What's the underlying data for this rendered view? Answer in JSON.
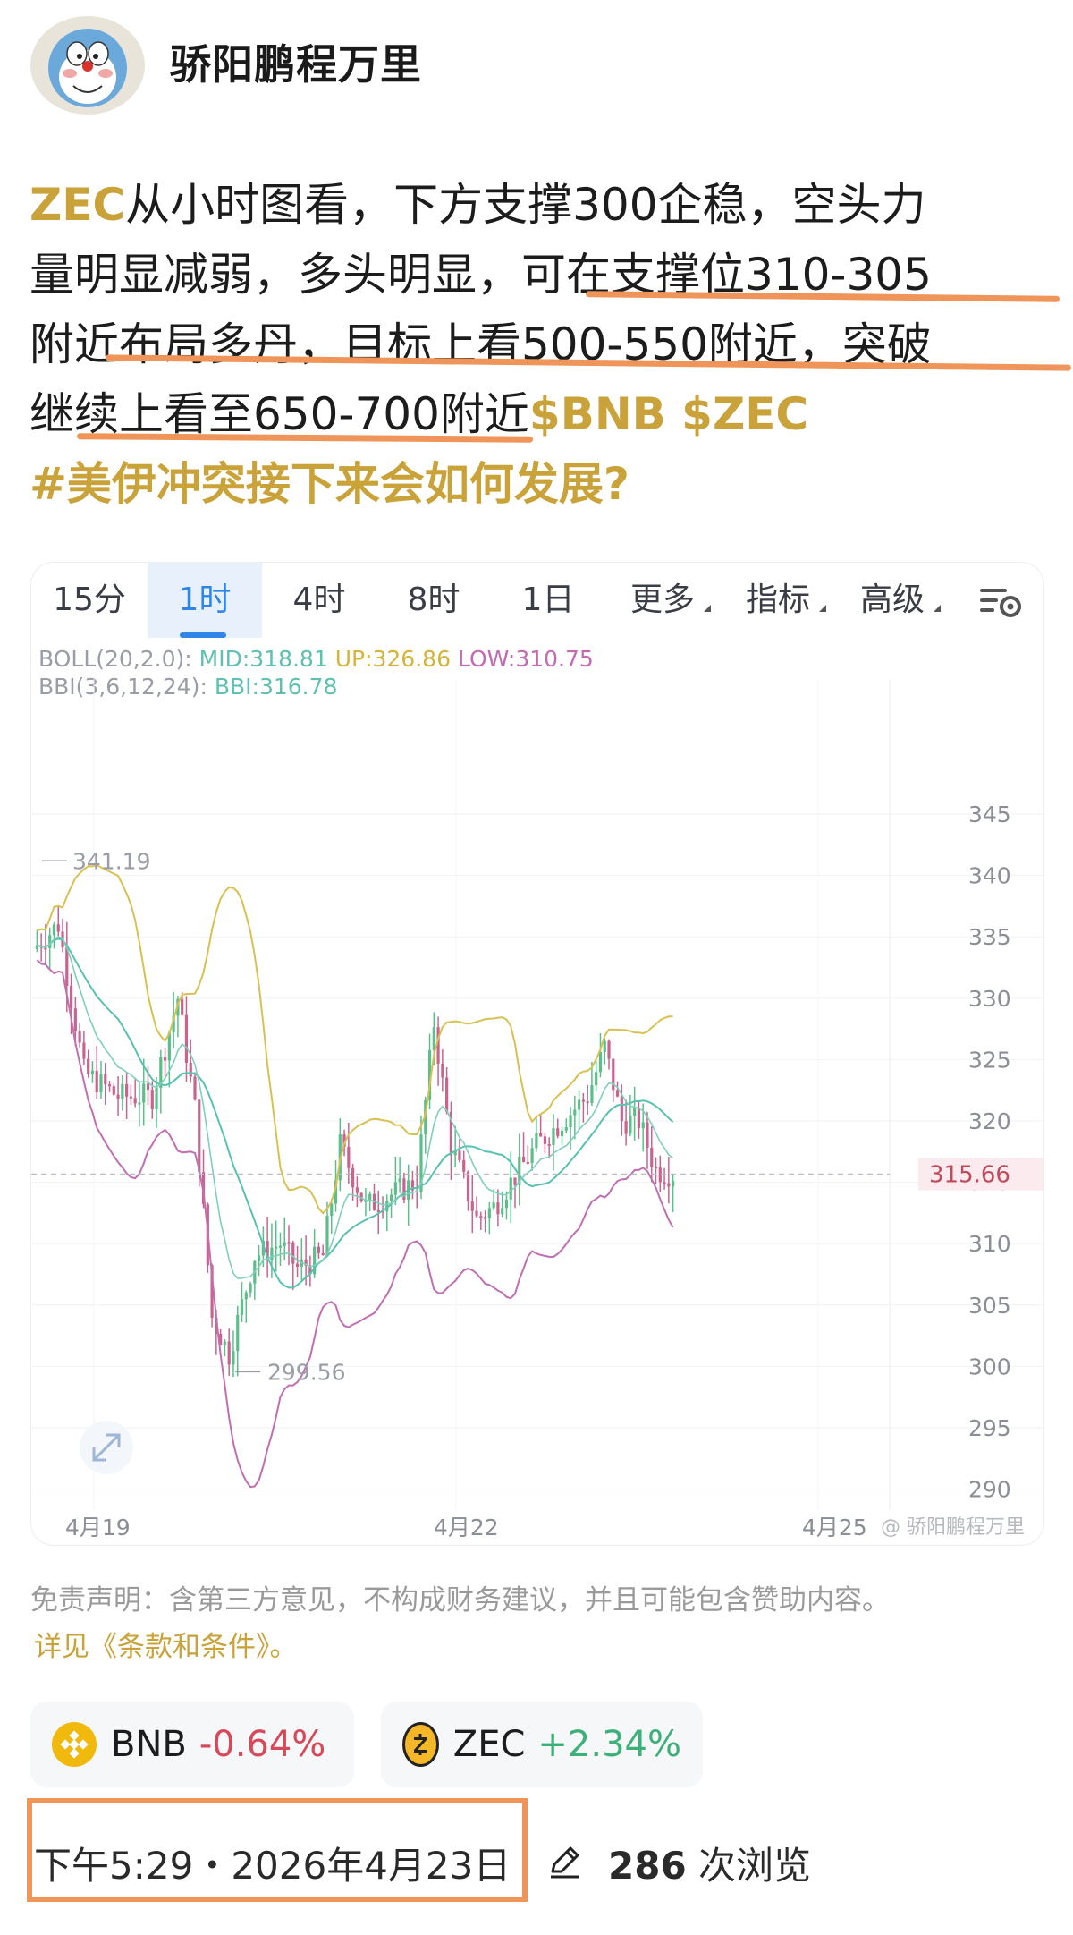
{
  "author": {
    "name": "骄阳鹏程万里"
  },
  "post": {
    "lines": [
      {
        "gold": "ZEC",
        "text": "从小时图看，下方支撑300企稳，空头力"
      },
      {
        "text": "量明显减弱，多头明显，可在支撑位310-305"
      },
      {
        "text": "附近布局多丹，目标上看500-550附近，突破"
      },
      {
        "text": "继续上看至650-700附近",
        "gold": "$BNB $ZEC"
      },
      {
        "gold": "#美伊冲突接下来会如何发展?"
      }
    ]
  },
  "chart": {
    "tabs": [
      {
        "label": "15分",
        "active": false
      },
      {
        "label": "1时",
        "active": true
      },
      {
        "label": "4时",
        "active": false
      },
      {
        "label": "8时",
        "active": false
      },
      {
        "label": "1日",
        "active": false
      },
      {
        "label": "更多",
        "active": false,
        "dropdown": true
      },
      {
        "label": "指标",
        "active": false,
        "dropdown": true
      },
      {
        "label": "高级",
        "active": false,
        "dropdown": true
      }
    ],
    "settings_icon": "chart-settings-icon",
    "legend": {
      "boll_label": "BOLL(20,2.0):",
      "mid": "MID:318.81",
      "up": "UP:326.86",
      "low": "LOW:310.75",
      "bbi_label": "BBI(3,6,12,24):",
      "bbi": "BBI:316.78"
    },
    "expand_icon": "expand-icon",
    "watermark": "@ 骄阳鹏程万里"
  },
  "chart_data": {
    "type": "candlestick",
    "y_ticks": [
      345,
      340,
      335,
      330,
      325,
      320,
      315,
      310,
      305,
      300,
      295,
      290
    ],
    "ylim": [
      288.5,
      349
    ],
    "x_labels": [
      "4月19",
      "4月22",
      "4月25"
    ],
    "current_price": "315.66",
    "high_label": "341.19",
    "low_label": "299.56",
    "indicators": {
      "MID": 318.81,
      "UP": 326.86,
      "LOW": 310.75,
      "BBI": 316.78
    },
    "colors": {
      "up": "#5cbf8a",
      "down": "#c9648e",
      "boll_up": "#d8c152",
      "boll_mid": "#59c1b0",
      "boll_low": "#c06fb0",
      "bbi": "#7fcfba",
      "price_line": "#b9bcc2"
    }
  },
  "disclaimer": {
    "text": "免责声明：含第三方意见，不构成财务建议，并且可能包含赞助内容。",
    "link": "详见《条款和条件》。"
  },
  "tickers": [
    {
      "symbol": "BNB",
      "change": "-0.64%",
      "color": "#d9475a"
    },
    {
      "symbol": "ZEC",
      "change": "+2.34%",
      "color": "#3db07a"
    }
  ],
  "footer": {
    "time": "下午5:29・2026年4月23日",
    "views_count": "286",
    "views_label": "次浏览"
  }
}
